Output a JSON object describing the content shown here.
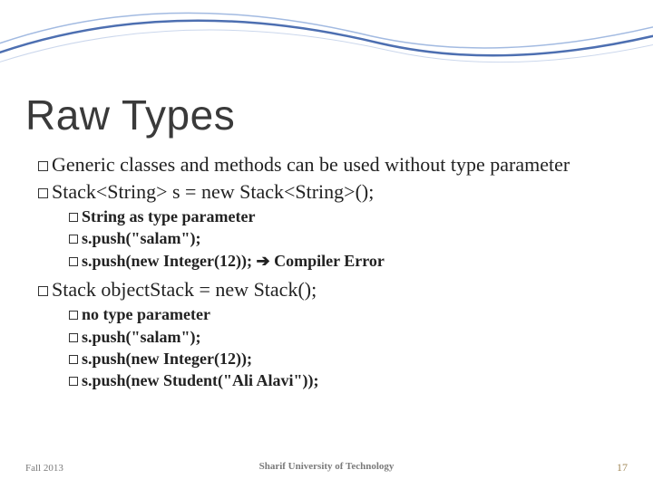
{
  "title": "Raw Types",
  "bullets": {
    "b1": "Generic classes and methods can be used without type parameter",
    "b2": "Stack<String> s = new Stack<String>();",
    "b2_1": "String as type parameter",
    "b2_2": "s.push(\"salam\");",
    "b2_3_a": "s.push(new Integer(12)); ",
    "b2_3_arrow": "➔",
    "b2_3_b": " Compiler Error",
    "b3": "Stack objectStack = new Stack();",
    "b3_1": "no type parameter",
    "b3_2": "s.push(\"salam\");",
    "b3_3": "s.push(new Integer(12));",
    "b3_4": "s.push(new Student(\"Ali Alavi\"));"
  },
  "footer": {
    "left": "Fall 2013",
    "center": "Sharif University of Technology",
    "page": "17"
  }
}
